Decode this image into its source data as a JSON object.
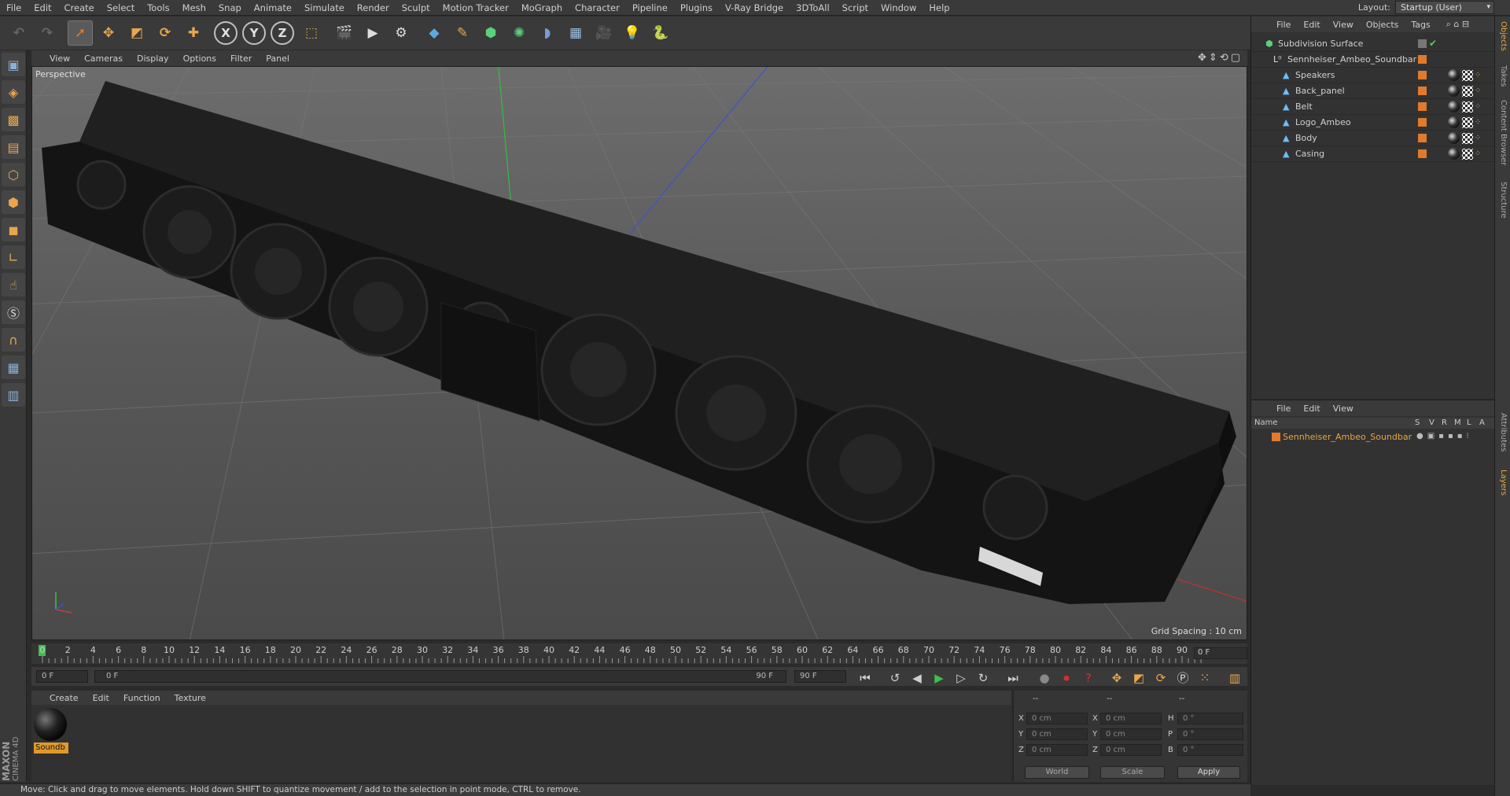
{
  "menu": [
    "File",
    "Edit",
    "Create",
    "Select",
    "Tools",
    "Mesh",
    "Snap",
    "Animate",
    "Simulate",
    "Render",
    "Sculpt",
    "Motion Tracker",
    "MoGraph",
    "Character",
    "Pipeline",
    "Plugins",
    "V-Ray Bridge",
    "3DToAll",
    "Script",
    "Window",
    "Help"
  ],
  "layout": {
    "label": "Layout:",
    "value": "Startup (User)"
  },
  "toolbar": {
    "axis_x": "X",
    "axis_y": "Y",
    "axis_z": "Z"
  },
  "viewport": {
    "menu": [
      "View",
      "Cameras",
      "Display",
      "Options",
      "Filter",
      "Panel"
    ],
    "label": "Perspective",
    "grid_spacing": "Grid Spacing : 10 cm"
  },
  "timeline": {
    "ticks": [
      "0",
      "2",
      "4",
      "6",
      "8",
      "10",
      "12",
      "14",
      "16",
      "18",
      "20",
      "22",
      "24",
      "26",
      "28",
      "30",
      "32",
      "34",
      "36",
      "38",
      "40",
      "42",
      "44",
      "46",
      "48",
      "50",
      "52",
      "54",
      "56",
      "58",
      "60",
      "62",
      "64",
      "66",
      "68",
      "70",
      "72",
      "74",
      "76",
      "78",
      "80",
      "82",
      "84",
      "86",
      "88",
      "90"
    ],
    "frame_right": "0 F",
    "start_field": "0 F",
    "range_start": "0 F",
    "range_end": "90 F",
    "end_field": "90 F"
  },
  "material": {
    "menu": [
      "Create",
      "Edit",
      "Function",
      "Texture"
    ],
    "name": "Soundb"
  },
  "coords": {
    "header": [
      "--",
      "--",
      "--"
    ],
    "pos_labels": [
      "X",
      "Y",
      "Z"
    ],
    "pos_values": [
      "0 cm",
      "0 cm",
      "0 cm"
    ],
    "size_labels": [
      "X",
      "Y",
      "Z"
    ],
    "size_values": [
      "0 cm",
      "0 cm",
      "0 cm"
    ],
    "rot_labels": [
      "H",
      "P",
      "B"
    ],
    "rot_values": [
      "0 °",
      "0 °",
      "0 °"
    ],
    "world": "World",
    "scale": "Scale",
    "apply": "Apply"
  },
  "status": "Move: Click and drag to move elements. Hold down SHIFT to quantize movement / add to the selection in point mode, CTRL to remove.",
  "object_manager": {
    "menu": [
      "File",
      "Edit",
      "View",
      "Objects",
      "Tags"
    ],
    "objects": [
      {
        "name": "Subdivision Surface",
        "level": 0
      },
      {
        "name": "Sennheiser_Ambeo_Soundbar",
        "level": 1
      },
      {
        "name": "Speakers",
        "level": 2
      },
      {
        "name": "Back_panel",
        "level": 2
      },
      {
        "name": "Belt",
        "level": 2
      },
      {
        "name": "Logo_Ambeo",
        "level": 2
      },
      {
        "name": "Body",
        "level": 2
      },
      {
        "name": "Casing",
        "level": 2
      }
    ]
  },
  "layer_manager": {
    "menu": [
      "File",
      "Edit",
      "View"
    ],
    "columns": [
      "Name",
      "S",
      "V",
      "R",
      "M",
      "L",
      "A"
    ],
    "layers": [
      {
        "name": "Sennheiser_Ambeo_Soundbar",
        "color": "#e07a2c"
      }
    ]
  },
  "side_tabs": [
    "Objects",
    "Takes",
    "Content Browser",
    "Structure",
    "Attributes",
    "Layers"
  ],
  "brand": {
    "top": "MAXON",
    "bottom": "CINEMA 4D"
  }
}
